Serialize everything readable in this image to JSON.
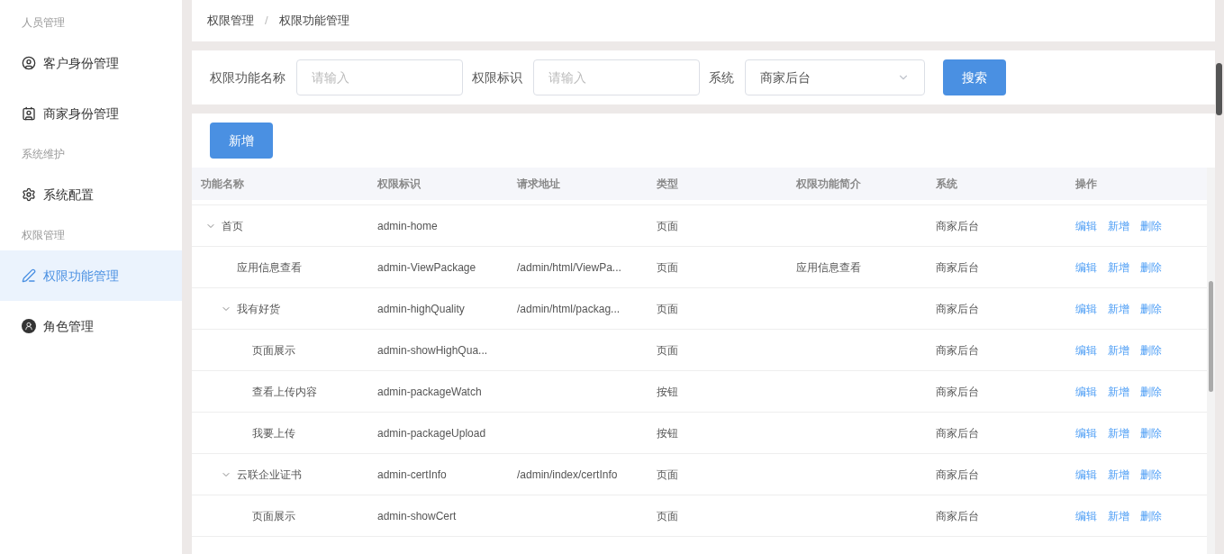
{
  "sidebar": {
    "groups": [
      {
        "title": "人员管理",
        "items": [
          {
            "label": "客户身份管理",
            "selected": false
          },
          {
            "label": "商家身份管理",
            "selected": false
          }
        ]
      },
      {
        "title": "系统维护",
        "items": [
          {
            "label": "系统配置",
            "selected": false
          }
        ]
      },
      {
        "title": "权限管理",
        "items": [
          {
            "label": "权限功能管理",
            "selected": true
          },
          {
            "label": "角色管理",
            "selected": false
          }
        ]
      }
    ]
  },
  "breadcrumb": {
    "items": [
      "权限管理",
      "权限功能管理"
    ],
    "separator": "/"
  },
  "filters": {
    "fields": [
      {
        "label": "权限功能名称",
        "placeholder": "请输入"
      },
      {
        "label": "权限标识",
        "placeholder": "请输入"
      }
    ],
    "select": {
      "label": "系统",
      "value": "商家后台"
    },
    "search_button": "搜索"
  },
  "add_button": "新增",
  "table": {
    "columns": [
      "功能名称",
      "权限标识",
      "请求地址",
      "类型",
      "权限功能简介",
      "系统",
      "操作"
    ],
    "rows": [
      {
        "name": "首页",
        "key": "admin-home",
        "type": "页面",
        "system": "商家后台",
        "actions": [
          "编辑",
          "新增",
          "删除"
        ],
        "expanded": true,
        "children": [
          {
            "name": "应用信息查看",
            "key": "admin-ViewPackage",
            "url": "/admin/html/ViewPa...",
            "type": "页面",
            "intro": "应用信息查看",
            "system": "商家后台",
            "actions": [
              "编辑",
              "新增",
              "删除"
            ]
          },
          {
            "name": "我有好货",
            "key": "admin-highQuality",
            "url": "/admin/html/packag...",
            "type": "页面",
            "system": "商家后台",
            "actions": [
              "编辑",
              "新增",
              "删除"
            ],
            "expanded": true,
            "children": [
              {
                "name": "页面展示",
                "key": "admin-showHighQua...",
                "type": "页面",
                "system": "商家后台",
                "actions": [
                  "编辑",
                  "新增",
                  "删除"
                ]
              },
              {
                "name": "查看上传内容",
                "key": "admin-packageWatch",
                "type": "按钮",
                "system": "商家后台",
                "actions": [
                  "编辑",
                  "新增",
                  "删除"
                ]
              },
              {
                "name": "我要上传",
                "key": "admin-packageUpload",
                "type": "按钮",
                "system": "商家后台",
                "actions": [
                  "编辑",
                  "新增",
                  "删除"
                ]
              }
            ]
          },
          {
            "name": "云联企业证书",
            "key": "admin-certInfo",
            "url": "/admin/index/certInfo",
            "type": "页面",
            "system": "商家后台",
            "actions": [
              "编辑",
              "新增",
              "删除"
            ],
            "expanded": true,
            "children": [
              {
                "name": "页面展示",
                "key": "admin-showCert",
                "type": "页面",
                "system": "商家后台",
                "actions": [
                  "编辑",
                  "新增",
                  "删除"
                ]
              }
            ]
          }
        ]
      }
    ]
  }
}
